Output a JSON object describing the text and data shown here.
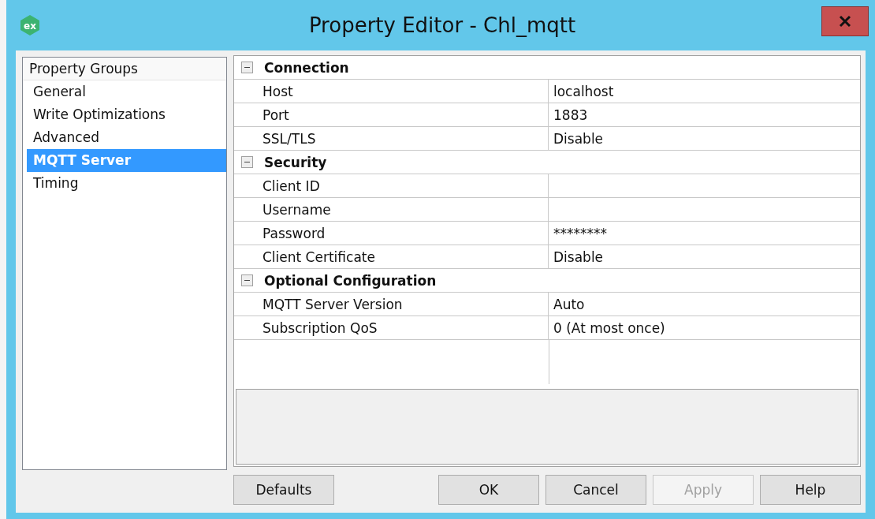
{
  "window": {
    "logo": "ex",
    "title": "Property Editor - Chl_mqtt"
  },
  "groups": {
    "header": "Property Groups",
    "items": [
      {
        "label": "General",
        "selected": false
      },
      {
        "label": "Write Optimizations",
        "selected": false
      },
      {
        "label": "Advanced",
        "selected": false
      },
      {
        "label": "MQTT Server",
        "selected": true
      },
      {
        "label": "Timing",
        "selected": false
      }
    ]
  },
  "property_grid": {
    "categories": [
      {
        "name": "Connection",
        "expanded": true,
        "properties": [
          {
            "name": "Host",
            "value": "localhost"
          },
          {
            "name": "Port",
            "value": "1883"
          },
          {
            "name": "SSL/TLS",
            "value": "Disable"
          }
        ]
      },
      {
        "name": "Security",
        "expanded": true,
        "properties": [
          {
            "name": "Client ID"
          },
          {
            "name": "Username"
          },
          {
            "name": "Password",
            "value": "********"
          },
          {
            "name": "Client Certificate",
            "value": "Disable"
          }
        ]
      },
      {
        "name": "Optional Configuration",
        "expanded": true,
        "properties": [
          {
            "name": "MQTT Server Version",
            "value": "Auto"
          },
          {
            "name": "Subscription QoS",
            "value": "0 (At most once)"
          }
        ]
      }
    ]
  },
  "buttons_left": [
    {
      "label": "Defaults",
      "disabled": false
    }
  ],
  "buttons_right": [
    {
      "label": "OK",
      "disabled": false
    },
    {
      "label": "Cancel",
      "disabled": false
    },
    {
      "label": "Apply",
      "disabled": true
    },
    {
      "label": "Help",
      "disabled": false
    }
  ]
}
